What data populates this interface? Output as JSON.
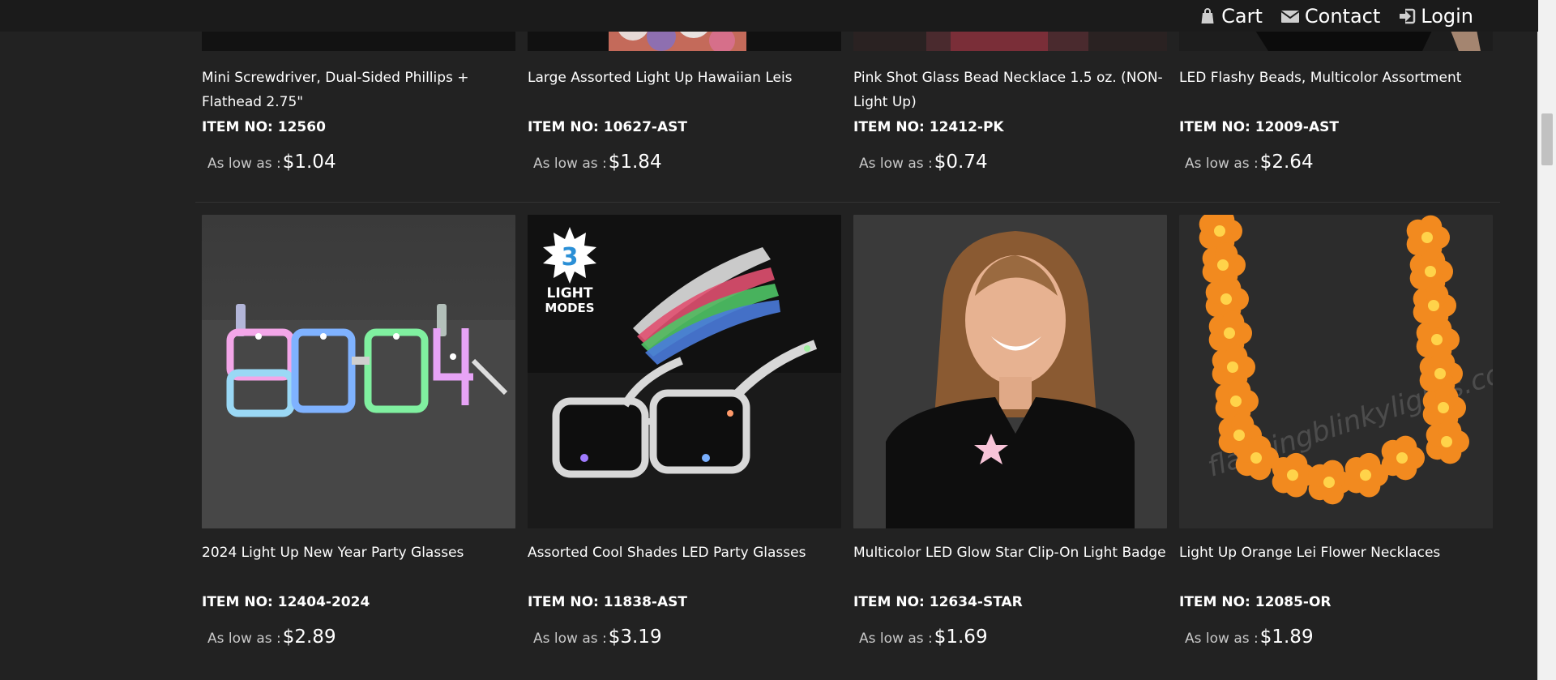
{
  "nav": {
    "cart": "Cart",
    "contact": "Contact",
    "login": "Login"
  },
  "products_row1": [
    {
      "name": "Mini Screwdriver, Dual-Sided Phillips + Flathead 2.75\"",
      "sku": "ITEM NO: 12560",
      "price_label": "As low as :",
      "price": "$1.04"
    },
    {
      "name": "Large Assorted Light Up Hawaiian Leis",
      "sku": "ITEM NO: 10627-AST",
      "price_label": "As low as :",
      "price": "$1.84"
    },
    {
      "name": "Pink Shot Glass Bead Necklace 1.5 oz. (NON-Light Up)",
      "sku": "ITEM NO: 12412-PK",
      "price_label": "As low as :",
      "price": "$0.74"
    },
    {
      "name": "LED Flashy Beads, Multicolor Assortment",
      "sku": "ITEM NO: 12009-AST",
      "price_label": "As low as :",
      "price": "$2.64"
    }
  ],
  "products_row2": [
    {
      "name": "2024 Light Up New Year Party Glasses",
      "sku": "ITEM NO: 12404-2024",
      "price_label": "As low as :",
      "price": "$2.89"
    },
    {
      "name": "Assorted Cool Shades LED Party Glasses",
      "sku": "ITEM NO: 11838-AST",
      "price_label": "As low as :",
      "price": "$3.19",
      "badge_number": "3",
      "badge_text": "LIGHT MODES"
    },
    {
      "name": "Multicolor LED Glow Star Clip-On Light Badge",
      "sku": "ITEM NO: 12634-STAR",
      "price_label": "As low as :",
      "price": "$1.69"
    },
    {
      "name": "Light Up Orange Lei Flower Necklaces",
      "sku": "ITEM NO: 12085-OR",
      "price_label": "As low as :",
      "price": "$1.89",
      "watermark": "flashingblinkylights.com"
    }
  ],
  "colors": {
    "background": "#222222",
    "topbar": "#1b1b1b",
    "price_label": "#c8c8c8"
  }
}
